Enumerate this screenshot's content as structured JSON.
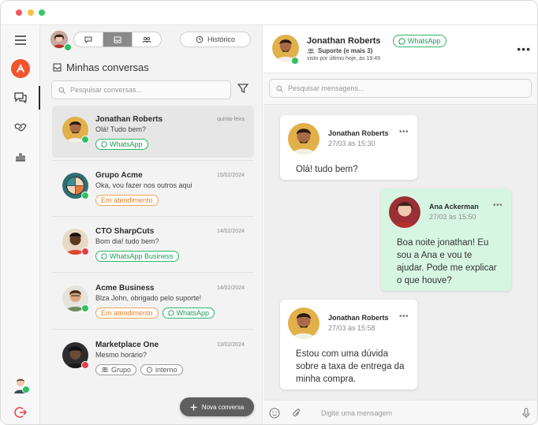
{
  "window": {
    "controls": [
      "close",
      "minimize",
      "maximize"
    ]
  },
  "rail": {
    "items": [
      {
        "icon": "menu-icon"
      },
      {
        "icon": "app-logo"
      },
      {
        "icon": "chat-icon",
        "active": true
      },
      {
        "icon": "handshake-icon"
      },
      {
        "icon": "bar-chart-icon"
      }
    ],
    "bottom": [
      {
        "icon": "user-avatar"
      },
      {
        "icon": "logout-icon"
      }
    ]
  },
  "list": {
    "segments": [
      {
        "icon": "chat-bubble-icon"
      },
      {
        "icon": "inbox-icon",
        "active": true
      },
      {
        "icon": "team-icon"
      }
    ],
    "history_label": "Histórico",
    "title": "Minhas conversas",
    "search_placeholder": "Pesquisar conversas...",
    "conversations": [
      {
        "name": "Jonathan Roberts",
        "date": "quinta-feira",
        "message": "Olá! Tudo bem?",
        "status": "online",
        "selected": true,
        "tags": [
          {
            "label": "WhatsApp",
            "type": "wa"
          }
        ]
      },
      {
        "name": "Grupo Acme",
        "date": "15/02/2024",
        "message": "Oka, vou fazer nos outros aqui",
        "status": "online",
        "tags": [
          {
            "label": "Em atendimento",
            "type": "att"
          }
        ]
      },
      {
        "name": "CTO SharpCuts",
        "date": "14/02/2024",
        "message": "Bom dia! tudo bem?",
        "status": "busy",
        "tags": [
          {
            "label": "WhatsApp Business",
            "type": "wa"
          }
        ]
      },
      {
        "name": "Acme Business",
        "date": "14/02/2024",
        "message": "Blza John, obrigado pelo suporte!",
        "status": "online",
        "tags": [
          {
            "label": "Em atendimento",
            "type": "att"
          },
          {
            "label": "WhatsApp",
            "type": "wa"
          }
        ]
      },
      {
        "name": "Marketplace One",
        "date": "13/02/2024",
        "message": "Mesmo horário?",
        "status": "busy",
        "tags": [
          {
            "label": "Grupo",
            "type": "gray"
          },
          {
            "label": "interno",
            "type": "gray"
          }
        ]
      }
    ],
    "new_conversation_label": "Nova conversa"
  },
  "chat": {
    "contact_name": "Jonathan Roberts",
    "channel_label": "WhatsApp",
    "team_label": "Suporte (e mais 3)",
    "last_seen": "visto por último hoje, às 19:49",
    "search_placeholder": "Pesquisar mensagens...",
    "messages": [
      {
        "author": "Jonathan Roberts",
        "time": "27/03 às 15:30",
        "text": "Olá! tudo bem?",
        "direction": "in"
      },
      {
        "author": "Ana Ackerman",
        "time": "27/03 às 15:50",
        "text_lines": [
          "Boa noite jonathan! Eu",
          "sou a Ana e vou te",
          "ajudar. Pode me explicar",
          "o que houve?"
        ],
        "direction": "out"
      },
      {
        "author": "Jonathan Roberts",
        "time": "27/03 às 15:58",
        "text_lines": [
          "Estou com uma dúvida",
          "sobre a taxa de entrega da",
          "minha compra."
        ],
        "direction": "in"
      }
    ],
    "composer_placeholder": "Digite uma mensagem",
    "composer_icons": [
      "emoji-icon",
      "attach-icon",
      "microphone-icon"
    ]
  },
  "colors": {
    "accent_green": "#2fb56a",
    "online": "#2ec060",
    "busy": "#e2414a",
    "attendance": "#f0a35c",
    "brand": "#f2542d"
  }
}
